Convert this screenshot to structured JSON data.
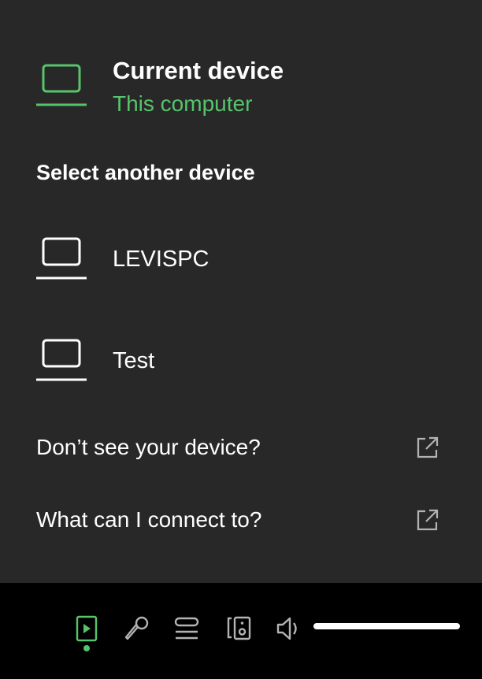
{
  "current_device": {
    "title": "Current device",
    "subtitle": "This computer",
    "icon": "laptop-icon"
  },
  "select_heading": "Select another device",
  "devices": [
    {
      "label": "LEVISPC",
      "icon": "laptop-icon"
    },
    {
      "label": "Test",
      "icon": "laptop-icon"
    }
  ],
  "links": [
    {
      "label": "Don’t see your device?",
      "icon": "external-link-icon"
    },
    {
      "label": "What can I connect to?",
      "icon": "external-link-icon"
    }
  ],
  "controls": {
    "now_playing": {
      "icon": "now-playing-view-icon",
      "active": true
    },
    "lyrics": {
      "icon": "microphone-icon"
    },
    "queue": {
      "icon": "queue-icon"
    },
    "connect_device": {
      "icon": "connect-device-icon"
    },
    "volume": {
      "icon": "speaker-icon",
      "level": 1.0
    }
  },
  "colors": {
    "accent": "#57c46b",
    "popup_background": "#282828",
    "bar_background": "#000000",
    "icon_gray": "#b3b3b3"
  }
}
